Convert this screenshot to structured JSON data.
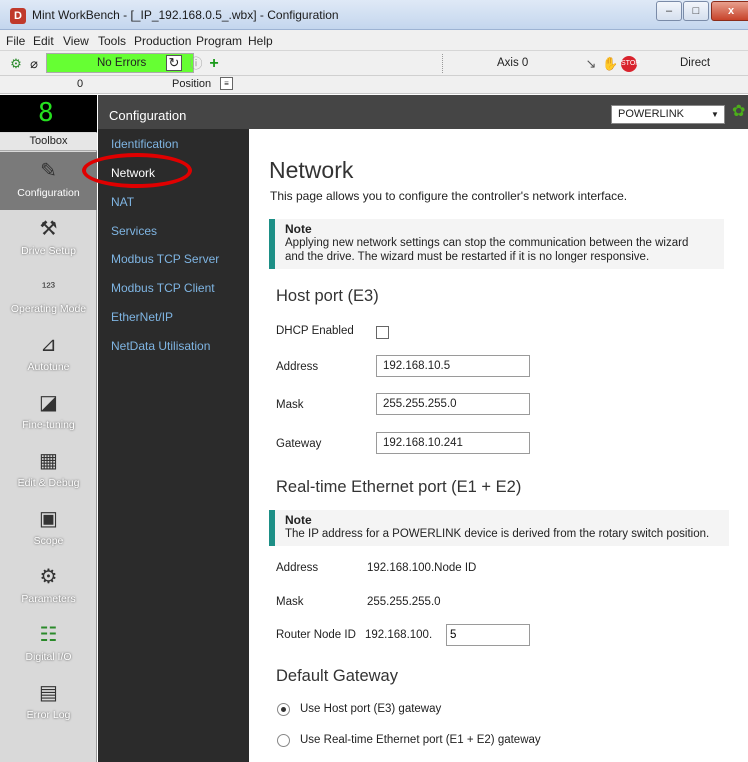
{
  "window": {
    "title": "Mint WorkBench - [_IP_192.168.0.5_.wbx] - Configuration",
    "min": "–",
    "max": "□",
    "close": "x"
  },
  "menu": [
    "File",
    "Edit",
    "View",
    "Tools",
    "Production",
    "Program",
    "Help"
  ],
  "toolbar": {
    "status": "No Errors",
    "axis": "Axis 0",
    "mode": "Direct",
    "value": "0",
    "position_label": "Position"
  },
  "toolbox": {
    "header": "Toolbox",
    "seven_segment": "8",
    "tools": [
      {
        "label": "Configuration",
        "icon": "configuration-icon",
        "active": true
      },
      {
        "label": "Drive Setup",
        "icon": "drive-setup-icon"
      },
      {
        "label": "Operating Mode",
        "icon": "operating-mode-icon"
      },
      {
        "label": "Autotune",
        "icon": "autotune-icon"
      },
      {
        "label": "Fine-tuning",
        "icon": "fine-tuning-icon"
      },
      {
        "label": "Edit & Debug",
        "icon": "edit-debug-icon"
      },
      {
        "label": "Scope",
        "icon": "scope-icon"
      },
      {
        "label": "Parameters",
        "icon": "parameters-icon"
      },
      {
        "label": "Digital I/O",
        "icon": "digital-io-icon"
      },
      {
        "label": "Error Log",
        "icon": "error-log-icon"
      }
    ]
  },
  "config": {
    "title": "Configuration",
    "dropdown": "POWERLINK",
    "nav": [
      "Identification",
      "Network",
      "NAT",
      "Services",
      "Modbus TCP Server",
      "Modbus TCP Client",
      "EtherNet/IP",
      "NetData Utilisation"
    ],
    "selected": "Network"
  },
  "page": {
    "title": "Network",
    "description": "This page allows you to configure the controller's network interface.",
    "note1": {
      "head": "Note",
      "line1": "Applying new network settings can stop the communication between the wizard",
      "line2": "and the drive. The wizard must be restarted if it is no longer responsive."
    },
    "host_section": "Host port (E3)",
    "dhcp_label": "DHCP Enabled",
    "address_label": "Address",
    "address_value": "192.168.10.5",
    "mask_label": "Mask",
    "mask_value": "255.255.255.0",
    "gateway_label": "Gateway",
    "gateway_value": "192.168.10.241",
    "rt_section": "Real-time Ethernet port (E1 + E2)",
    "note2": {
      "head": "Note",
      "text": "The IP address for a POWERLINK device is derived from the rotary switch position."
    },
    "rt_address_label": "Address",
    "rt_address_value": "192.168.100.Node ID",
    "rt_mask_label": "Mask",
    "rt_mask_value": "255.255.255.0",
    "router_label": "Router Node ID",
    "router_prefix": "192.168.100.",
    "router_value": "5",
    "gateway_section": "Default Gateway",
    "radio1": "Use Host port (E3) gateway",
    "radio2": "Use Real-time Ethernet port (E1 + E2) gateway"
  }
}
